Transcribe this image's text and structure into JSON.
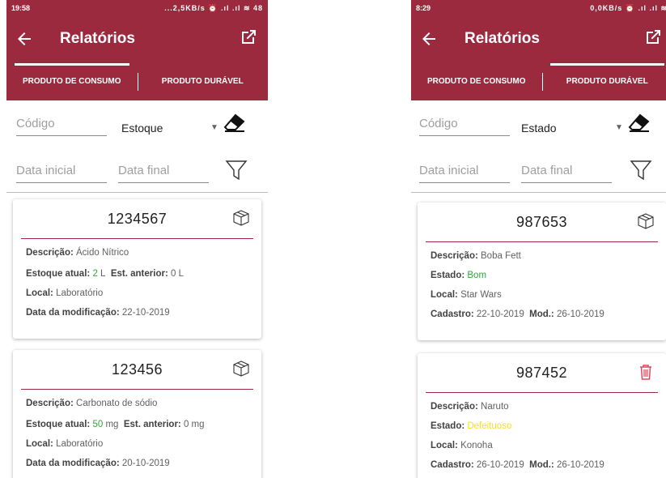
{
  "left": {
    "status_time": "19:58",
    "status_right": "...2,5KB/s ⏰ .ıl .ıl ≋ 48",
    "title": "Relatórios",
    "tabs": [
      {
        "label": "PRODUTO DE CONSUMO"
      },
      {
        "label": "PRODUTO DURÁVEL"
      }
    ],
    "filters": {
      "codigo_placeholder": "Código",
      "select_value": "Estoque",
      "data_inicial_placeholder": "Data inicial",
      "data_final_placeholder": "Data final"
    },
    "cards": [
      {
        "code": "1234567",
        "descricao_label": "Descrição:",
        "descricao_value": "Ácido Nítrico",
        "estoque_label": "Estoque atual:",
        "estoque_value": "2",
        "estoque_unit": "L",
        "anterior_label": "Est. anterior:",
        "anterior_value": "0 L",
        "local_label": "Local:",
        "local_value": "Laboratório",
        "data_label": "Data da modificação:",
        "data_value": "22-10-2019"
      },
      {
        "code": "123456",
        "descricao_label": "Descrição:",
        "descricao_value": "Carbonato de sódio",
        "estoque_label": "Estoque atual:",
        "estoque_value": "50",
        "estoque_unit": "mg",
        "anterior_label": "Est. anterior:",
        "anterior_value": "0 mg",
        "local_label": "Local:",
        "local_value": "Laboratório",
        "data_label": "Data da modificação:",
        "data_value": "20-10-2019"
      }
    ]
  },
  "right": {
    "status_time": "8:29",
    "status_right": "0,0KB/s ⏰ .ıl .ıl ≋",
    "title": "Relatórios",
    "tabs": [
      {
        "label": "PRODUTO DE CONSUMO"
      },
      {
        "label": "PRODUTO DURÁVEL"
      }
    ],
    "filters": {
      "codigo_placeholder": "Código",
      "select_value": "Estado",
      "data_inicial_placeholder": "Data inicial",
      "data_final_placeholder": "Data final"
    },
    "cards": [
      {
        "code": "987653",
        "descricao_label": "Descrição:",
        "descricao_value": "Boba Fett",
        "estado_label": "Estado:",
        "estado_value": "Bom",
        "local_label": "Local:",
        "local_value": "Star Wars",
        "cadastro_label": "Cadastro:",
        "cadastro_value": "22-10-2019",
        "mod_label": "Mod.:",
        "mod_value": "26-10-2019"
      },
      {
        "code": "987452",
        "descricao_label": "Descrição:",
        "descricao_value": "Naruto",
        "estado_label": "Estado:",
        "estado_value": "Defeituoso",
        "local_label": "Local:",
        "local_value": "Konoha",
        "cadastro_label": "Cadastro:",
        "cadastro_value": "26-10-2019",
        "mod_label": "Mod.:",
        "mod_value": "26-10-2019"
      }
    ]
  },
  "colors": {
    "primary": "#9c2a3f",
    "status_good": "#2ea836",
    "status_defective": "#f7e11e",
    "trash": "#e0485c"
  },
  "icons": [
    "back-arrow-icon",
    "share-icon",
    "eraser-icon",
    "filter-icon",
    "box-icon",
    "trash-icon",
    "chevron-down-icon"
  ]
}
